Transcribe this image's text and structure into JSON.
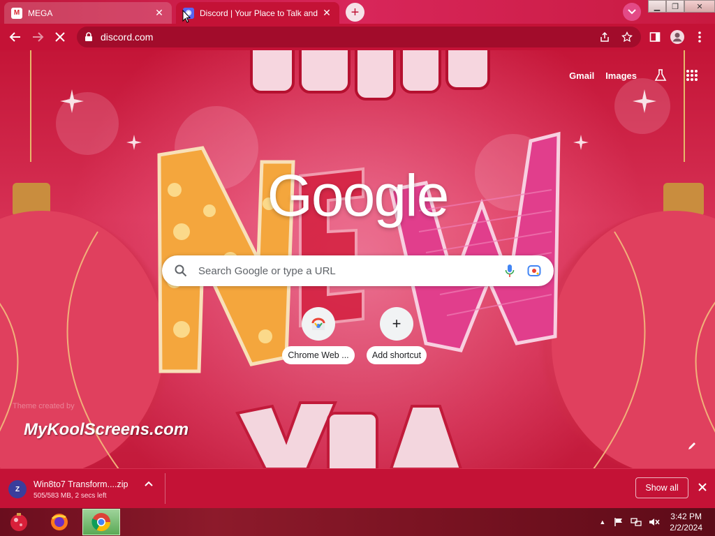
{
  "tabs": [
    {
      "title": "MEGA",
      "favicon": "mega-icon",
      "active": false
    },
    {
      "title": "Discord | Your Place to Talk and H",
      "favicon": "discord-icon",
      "active": true
    }
  ],
  "toolbar": {
    "url": "discord.com"
  },
  "page": {
    "nav": {
      "gmail": "Gmail",
      "images": "Images"
    },
    "logo": "Google",
    "search_placeholder": "Search Google or type a URL",
    "shortcuts": [
      {
        "label": "Chrome Web ...",
        "icon": "chrome-web-store-icon"
      },
      {
        "label": "Add shortcut",
        "icon": "plus-icon"
      }
    ],
    "theme_credit": "Theme created by",
    "watermark": "MyKoolScreens.com"
  },
  "download": {
    "filename": "Win8to7 Transform....zip",
    "status": "505/583 MB, 2 secs left",
    "show_all": "Show all"
  },
  "taskbar": {
    "time": "3:42 PM",
    "date": "2/2/2024"
  },
  "colors": {
    "chrome_frame": "#c41236",
    "accent_pink": "#e34a86"
  }
}
